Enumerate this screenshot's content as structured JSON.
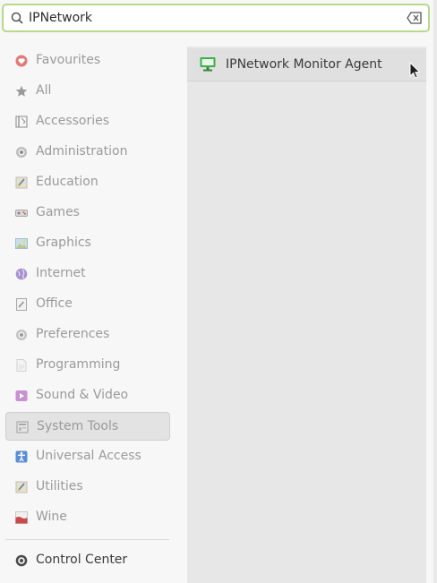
{
  "search": {
    "value": "IPNetwork",
    "icon": "search-icon",
    "clear_icon": "clear-text-icon"
  },
  "categories": [
    {
      "label": "Favourites",
      "icon": "heart-icon",
      "color": "#e07a7a"
    },
    {
      "label": "All",
      "icon": "star-icon",
      "color": "#9a9a9a"
    },
    {
      "label": "Accessories",
      "icon": "accessories-icon",
      "color": "#9a9a9a"
    },
    {
      "label": "Administration",
      "icon": "administration-icon",
      "color": "#9a9a9a"
    },
    {
      "label": "Education",
      "icon": "education-icon",
      "color": "#7aa6d8"
    },
    {
      "label": "Games",
      "icon": "gamepad-icon",
      "color": "#b57a7a"
    },
    {
      "label": "Graphics",
      "icon": "image-icon",
      "color": "#8ab6c8"
    },
    {
      "label": "Internet",
      "icon": "globe-icon",
      "color": "#9b86c9"
    },
    {
      "label": "Office",
      "icon": "document-icon",
      "color": "#9a9a9a"
    },
    {
      "label": "Preferences",
      "icon": "preferences-icon",
      "color": "#9a9a9a"
    },
    {
      "label": "Programming",
      "icon": "code-file-icon",
      "color": "#cfcfcf"
    },
    {
      "label": "Sound & Video",
      "icon": "media-icon",
      "color": "#c07ac8"
    },
    {
      "label": "System Tools",
      "icon": "system-tools-icon",
      "color": "#b0b0b0",
      "selected": true
    },
    {
      "label": "Universal Access",
      "icon": "accessibility-icon",
      "color": "#5b8ed6"
    },
    {
      "label": "Utilities",
      "icon": "utilities-icon",
      "color": "#7aa6d8"
    },
    {
      "label": "Wine",
      "icon": "wine-icon",
      "color": "#c94a4a"
    }
  ],
  "control_center": {
    "label": "Control Center",
    "icon": "control-center-icon"
  },
  "results": [
    {
      "label": "IPNetwork Monitor Agent",
      "icon": "monitor-icon",
      "color": "#3fae49"
    }
  ]
}
